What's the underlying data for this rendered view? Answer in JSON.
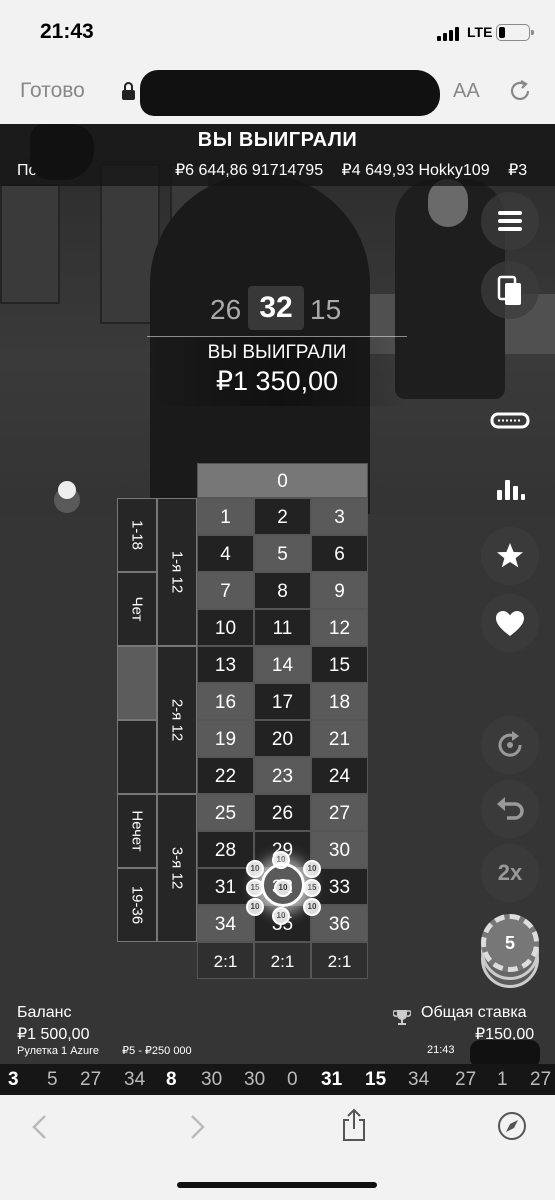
{
  "status": {
    "time": "21:43",
    "network": "LTE"
  },
  "browser": {
    "done": "Готово",
    "text_size": "AA"
  },
  "game": {
    "win_banner": "ВЫ ВЫИГРАЛИ",
    "ticker_label": "По        ели:",
    "ticker_items": [
      "₽6 644,86 91714795",
      "₽4 649,93 Hokky109",
      "₽3"
    ],
    "result_prev": "26",
    "result_main": "32",
    "result_next": "15",
    "win_title": "ВЫ ВЫИГРАЛИ",
    "win_amount": "₽1 350,00",
    "zero": "0",
    "numbers": [
      [
        "1",
        "2",
        "3"
      ],
      [
        "4",
        "5",
        "6"
      ],
      [
        "7",
        "8",
        "9"
      ],
      [
        "10",
        "11",
        "12"
      ],
      [
        "13",
        "14",
        "15"
      ],
      [
        "16",
        "17",
        "18"
      ],
      [
        "19",
        "20",
        "21"
      ],
      [
        "22",
        "23",
        "24"
      ],
      [
        "25",
        "26",
        "27"
      ],
      [
        "28",
        "29",
        "30"
      ],
      [
        "31",
        "32",
        "33"
      ],
      [
        "34",
        "35",
        "36"
      ]
    ],
    "columns": [
      "2:1",
      "2:1",
      "2:1"
    ],
    "dozens": [
      "1-я 12",
      "2-я 12",
      "3-я 12"
    ],
    "outside": [
      "1-18",
      "Чет",
      "",
      "",
      "Нечет",
      "19-36"
    ],
    "chip_values": [
      "10",
      "10",
      "10",
      "15",
      "10",
      "15",
      "10",
      "10",
      "10"
    ],
    "selected_chip": "5",
    "double_label": "2x"
  },
  "footer": {
    "balance_label": "Баланс",
    "balance_value": "₽1 500,00",
    "table_name": "Рулетка 1 Azure",
    "limits": "₽5 - ₽250 000",
    "total_label": "Общая ставка",
    "total_value": "₽150,00",
    "clock": "21:43"
  },
  "history": [
    "3",
    "5",
    "27",
    "34",
    "8",
    "30",
    "30",
    "0",
    "31",
    "15",
    "34",
    "27",
    "1",
    "27"
  ],
  "colors": {
    "chrome_bg": "#f2f2f2",
    "game_bg": "#262626",
    "red_cell": "#5a5a5a",
    "black_cell": "#222222",
    "zero_cell": "#777777"
  },
  "icons": [
    "lock-icon",
    "reload-icon",
    "menu-icon",
    "cards-icon",
    "racetrack-icon",
    "stats-icon",
    "star-icon",
    "heart-icon",
    "repeat-icon",
    "undo-icon",
    "trophy-icon",
    "back-icon",
    "forward-icon",
    "share-icon",
    "compass-icon"
  ]
}
